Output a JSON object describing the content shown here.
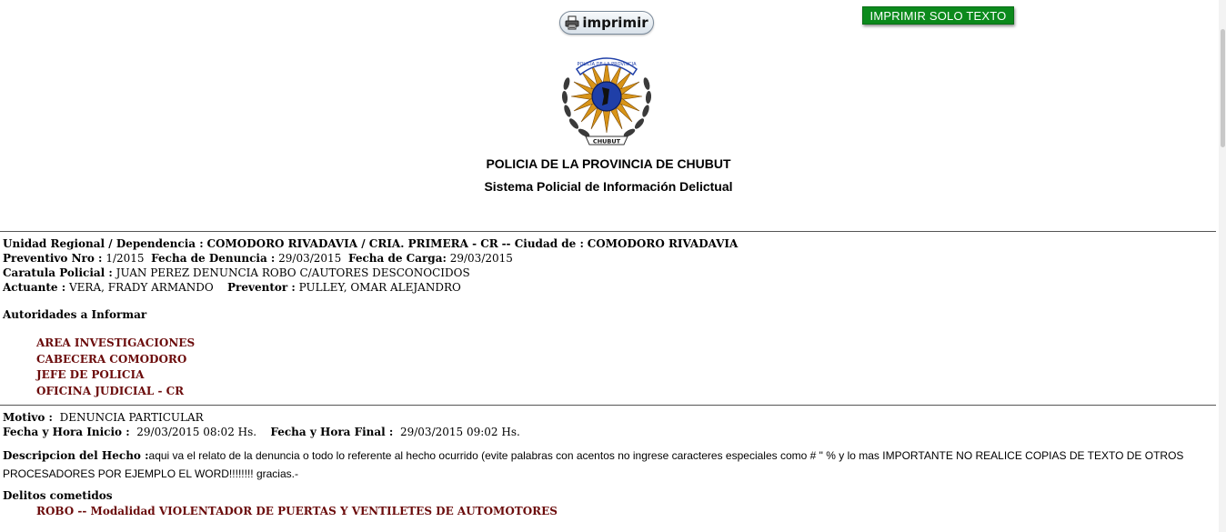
{
  "toolbar": {
    "print_label": "imprimir",
    "text_only_label": "IMPRIMIR SOLO TEXTO"
  },
  "emblem": {
    "top_text": "POLICIA DE LA PROVINCIA",
    "bottom_text": "CHUBUT"
  },
  "header": {
    "org": "POLICIA DE LA PROVINCIA DE CHUBUT",
    "system": "Sistema Policial de Información Delictual"
  },
  "record": {
    "unidad_label": "Unidad Regional / Dependencia :",
    "unidad_value": "COMODORO RIVADAVIA / CRIA. PRIMERA - CR",
    "ciudad_label": "-- Ciudad de :",
    "ciudad_value": "COMODORO RIVADAVIA",
    "preventivo_label": "Preventivo Nro :",
    "preventivo_value": "1/2015",
    "fecha_denuncia_label": "Fecha de Denuncia :",
    "fecha_denuncia_value": "29/03/2015",
    "fecha_carga_label": "Fecha de Carga:",
    "fecha_carga_value": "29/03/2015",
    "caratula_label": "Caratula Policial :",
    "caratula_value": "JUAN PEREZ DENUNCIA ROBO C/AUTORES DESCONOCIDOS",
    "actuante_label": "Actuante :",
    "actuante_value": "VERA, FRADY ARMANDO",
    "preventor_label": "Preventor :",
    "preventor_value": "PULLEY, OMAR ALEJANDRO"
  },
  "autoridades": {
    "title": "Autoridades a Informar",
    "items": [
      "AREA INVESTIGACIONES",
      "CABECERA COMODORO",
      "JEFE DE POLICIA",
      "OFICINA JUDICIAL - CR"
    ]
  },
  "hecho": {
    "motivo_label": "Motivo :",
    "motivo_value": "DENUNCIA PARTICULAR",
    "inicio_label": "Fecha y Hora Inicio :",
    "inicio_value": "29/03/2015 08:02 Hs.",
    "final_label": "Fecha y Hora Final :",
    "final_value": "29/03/2015 09:02 Hs.",
    "descripcion_label": "Descripcion del Hecho :",
    "descripcion_value": "aqui va el relato de la denuncia o todo lo referente al hecho ocurrido  (evite palabras con acentos no ingrese caracteres especiales como # \" % y lo mas IMPORTANTE NO REALICE COPIAS DE TEXTO DE OTROS PROCESADORES POR EJEMPLO EL WORD!!!!!!!! gracias.-",
    "delitos_label": "Delitos cometidos",
    "delito_item": "ROBO -- Modalidad VIOLENTADOR DE PUERTAS Y VENTILETES DE AUTOMOTORES"
  },
  "colors": {
    "accent_green": "#0c8a1c",
    "item_maroon": "#6b0b0b"
  }
}
